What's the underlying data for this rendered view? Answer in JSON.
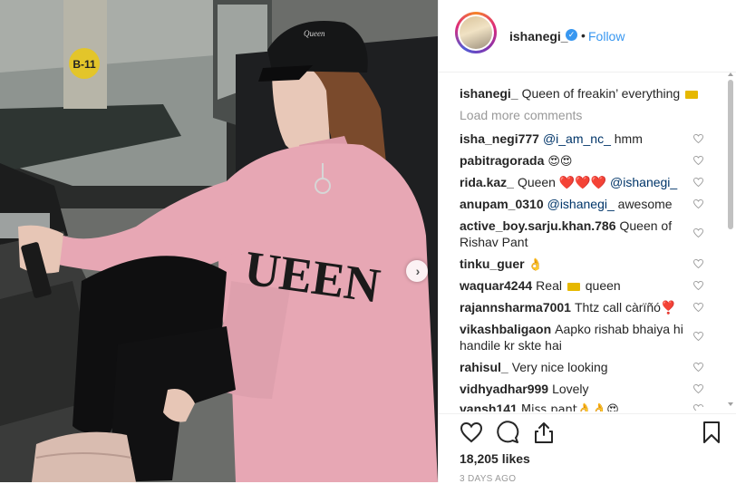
{
  "post": {
    "username": "ishanegi_",
    "verified": true,
    "separator": "•",
    "follow_label": "Follow",
    "caption_user": "ishanegi_",
    "caption_text": "Queen of freakin’ everything",
    "caption_emoji": "crown",
    "load_more_label": "Load more comments",
    "likes": "18,205 likes",
    "date": "3 DAYS AGO",
    "photo_texts": {
      "pillar_sign": "B-11",
      "cap_text": "Queen",
      "shirt_text": "UEEN"
    }
  },
  "comments": [
    {
      "user": "isha_negi777",
      "mention": "@i_am_nc_",
      "text": " hmm"
    },
    {
      "user": "pabitragorada",
      "text": "😍😍"
    },
    {
      "user": "rida.kaz_",
      "text": "Queen ❤️❤️❤️",
      "mention": "@ishanegi_"
    },
    {
      "user": "anupam_0310",
      "mention": "@ishanegi_",
      "text": " awesome"
    },
    {
      "user": "active_boy.sarju.khan.786",
      "text": "Queen of Rishav Pant"
    },
    {
      "user": "tinku_guer",
      "text": "👌"
    },
    {
      "user": "waquar4244",
      "text": "Real",
      "text2": "queen"
    },
    {
      "user": "rajannsharma7001",
      "text": "Thtz call càrïñó❣️"
    },
    {
      "user": "vikashbaligaon",
      "text": "Aapko rishab bhaiya hi handile kr skte hai"
    },
    {
      "user": "rahisul_",
      "text": "Very nice looking"
    },
    {
      "user": "vidhyadhar999",
      "text": "Lovely"
    },
    {
      "user": "vansh141",
      "text": "Miss pant👌👌😍"
    }
  ],
  "icons": {
    "like": "heart-outline-icon",
    "comment": "comment-bubble-icon",
    "share": "share-upload-icon",
    "save": "bookmark-icon",
    "comment_like": "heart-small-icon",
    "verified": "verified-badge-icon",
    "carousel": "chevron-right-icon"
  },
  "colors": {
    "link": "#3897f0",
    "text": "#262626",
    "muted": "#999999",
    "shirt": "#e7a7b4"
  }
}
